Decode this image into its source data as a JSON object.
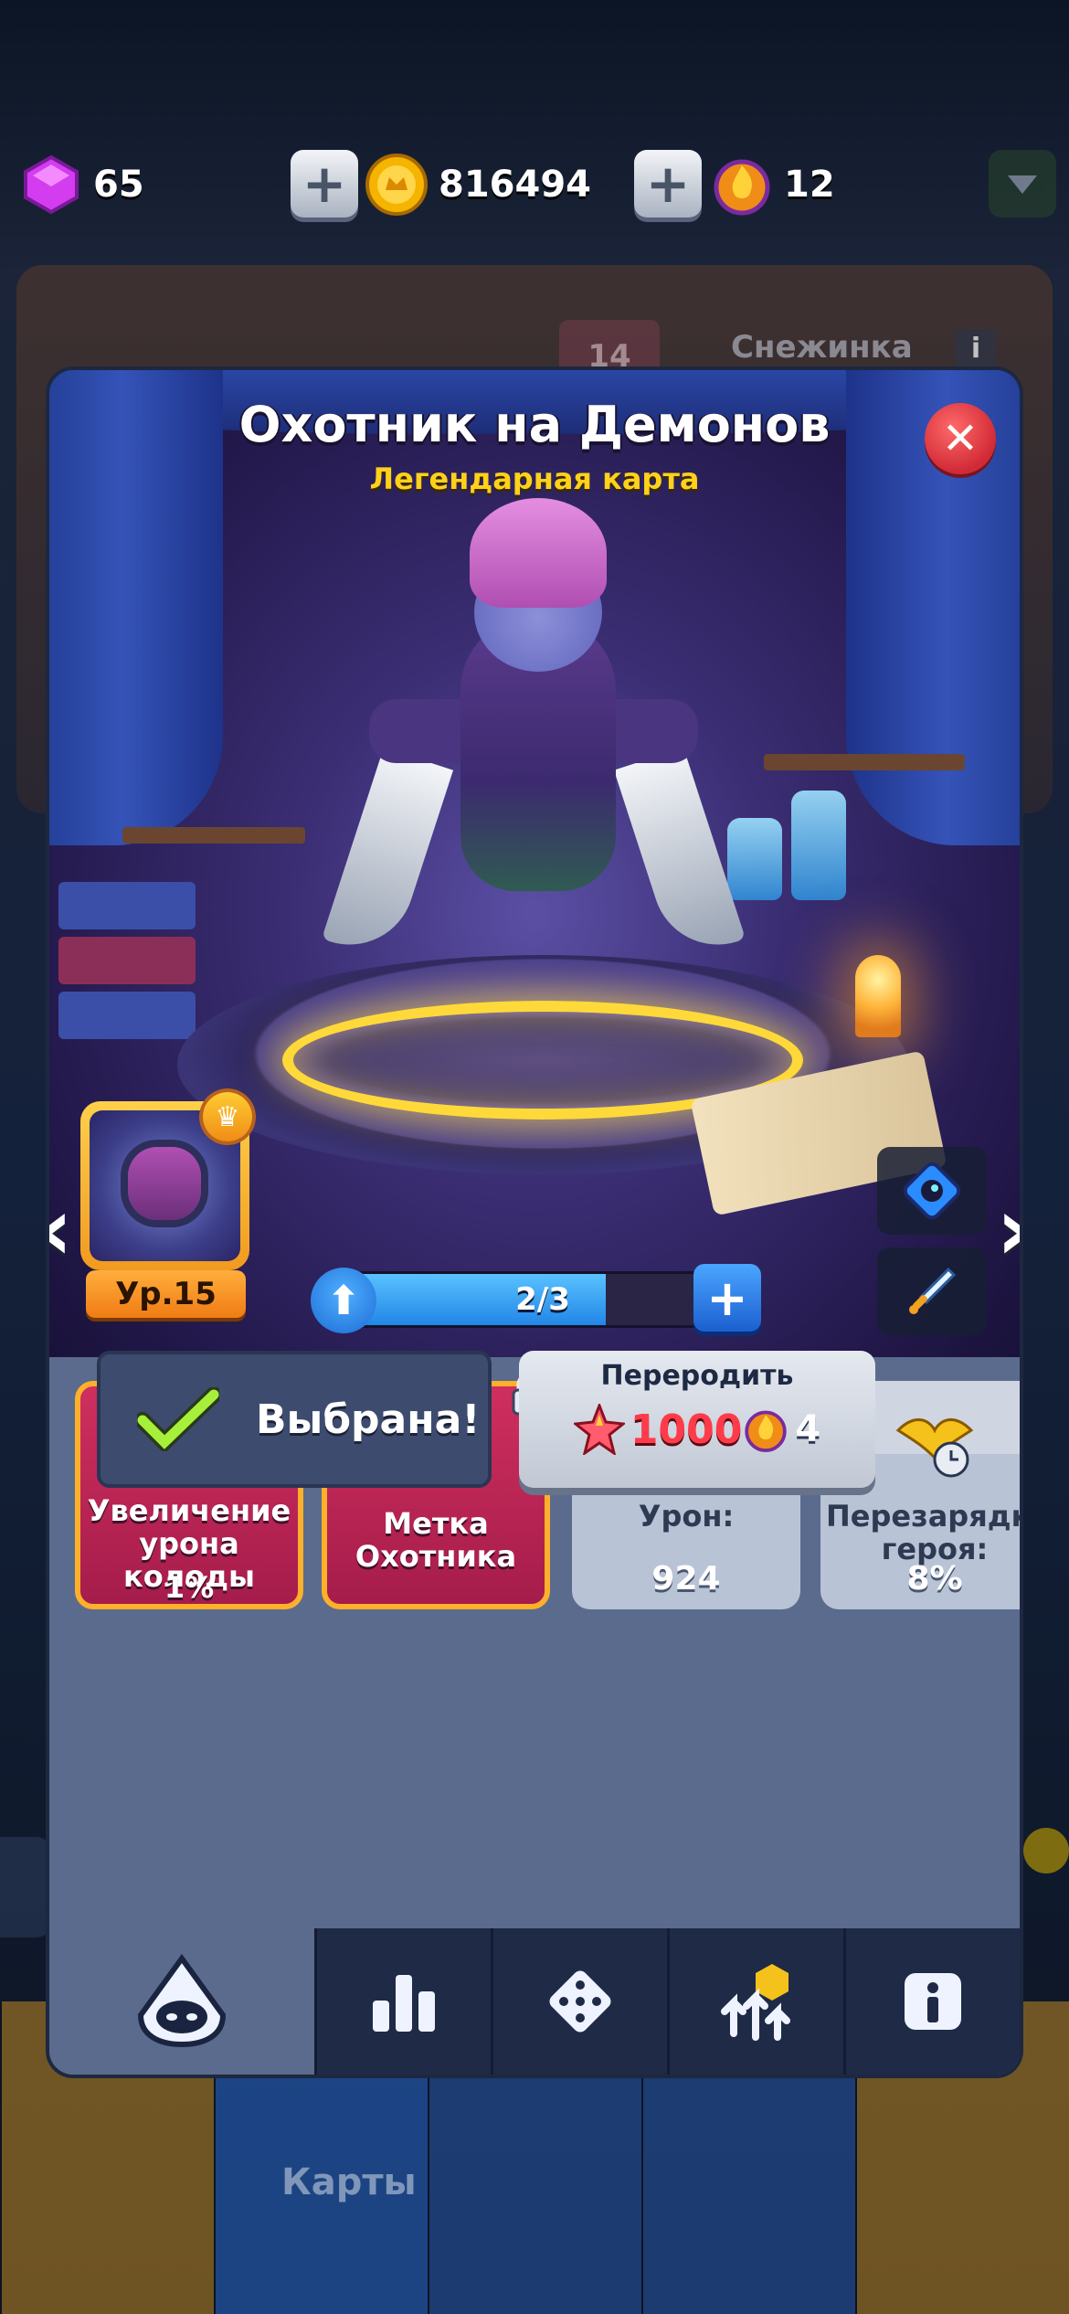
{
  "currencies": {
    "gems": "65",
    "coins": "816494",
    "trophies": "12"
  },
  "background": {
    "card_level": "14",
    "card_name": "Снежинка",
    "bottom_label": "Карты"
  },
  "modal": {
    "title": "Охотник на Демонов",
    "subtitle": "Легендарная карта",
    "level": "Ур.15",
    "progress": {
      "text": "2/3",
      "fraction": 0.667
    }
  },
  "stats": [
    {
      "label": "Увеличение урона колоды",
      "value": "1%",
      "style": "talent",
      "locked": true,
      "icon": "winged-shield-icon"
    },
    {
      "label": "Метка Охотника",
      "value": "",
      "style": "talent",
      "locked": true,
      "icon": "bomb-dice-icon"
    },
    {
      "label": "Урон:",
      "value": "924",
      "style": "stat",
      "locked": false,
      "icon": "sword-icon"
    },
    {
      "label": "Перезарядка героя:",
      "value": "8%",
      "style": "stat",
      "locked": false,
      "icon": "eagle-clock-icon"
    }
  ],
  "buttons": {
    "selected": "Выбрана!",
    "reroll_title": "Перeродить",
    "reroll_cost": "1000",
    "reroll_count": "4"
  },
  "tabs": [
    {
      "icon": "hero-hood-icon",
      "active": true
    },
    {
      "icon": "bar-chart-icon",
      "active": false
    },
    {
      "icon": "dice-icon",
      "active": false
    },
    {
      "icon": "upgrade-arrows-icon",
      "active": false
    },
    {
      "icon": "info-icon",
      "active": false
    }
  ],
  "colors": {
    "legendary_text": "#ffd11a",
    "talent_card": "#c0275a",
    "talent_border": "#ffb02a",
    "close_button": "#d12a35"
  }
}
